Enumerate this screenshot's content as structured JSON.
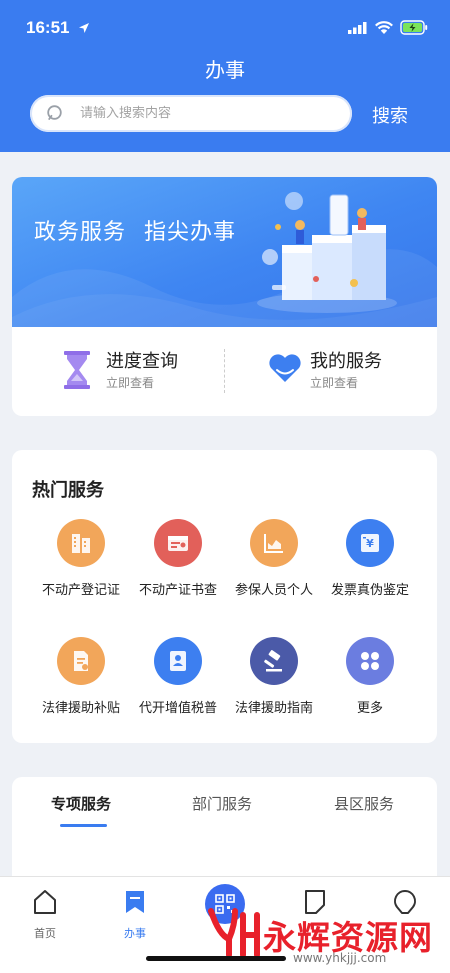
{
  "status_bar": {
    "time": "16:51"
  },
  "header": {
    "title": "办事",
    "search_placeholder": "请输入搜索内容",
    "search_button": "搜索"
  },
  "banner": {
    "text_1": "政务服务",
    "text_2": "指尖办事"
  },
  "quick_actions": [
    {
      "title": "进度查询",
      "subtitle": "立即查看",
      "icon": "hourglass-icon",
      "color": "#8f6ee8"
    },
    {
      "title": "我的服务",
      "subtitle": "立即查看",
      "icon": "heart-icon",
      "color": "#3d7ff0"
    }
  ],
  "hot_services": {
    "title": "热门服务",
    "items": [
      {
        "label": "不动产登记证",
        "icon": "building-icon",
        "color": "#f2a65a"
      },
      {
        "label": "不动产证书查",
        "icon": "certificate-icon",
        "color": "#e2605a"
      },
      {
        "label": "参保人员个人",
        "icon": "chart-icon",
        "color": "#f2a65a"
      },
      {
        "label": "发票真伪鉴定",
        "icon": "invoice-icon",
        "color": "#3d7ff0"
      },
      {
        "label": "法律援助补贴",
        "icon": "document-icon",
        "color": "#f2a65a"
      },
      {
        "label": "代开增值税普",
        "icon": "id-card-icon",
        "color": "#3d7ff0"
      },
      {
        "label": "法律援助指南",
        "icon": "gavel-icon",
        "color": "#4b5aa8"
      },
      {
        "label": "更多",
        "icon": "more-icon",
        "color": "#6b7de0"
      }
    ]
  },
  "service_tabs": [
    {
      "label": "专项服务",
      "active": true
    },
    {
      "label": "部门服务",
      "active": false
    },
    {
      "label": "县区服务",
      "active": false
    }
  ],
  "bottom_nav": [
    {
      "label": "首页",
      "icon": "home-icon",
      "active": false
    },
    {
      "label": "办事",
      "icon": "bookmark-icon",
      "active": true
    },
    {
      "label": "",
      "icon": "qr-code-icon",
      "active": false
    },
    {
      "label": "",
      "icon": "note-icon",
      "active": false
    },
    {
      "label": "",
      "icon": "user-icon",
      "active": false
    }
  ],
  "watermark": {
    "title": "永辉资源网",
    "url": "www.yhkjjj.com"
  },
  "colors": {
    "brand": "#3a7cf0",
    "background": "#eef1f6"
  }
}
